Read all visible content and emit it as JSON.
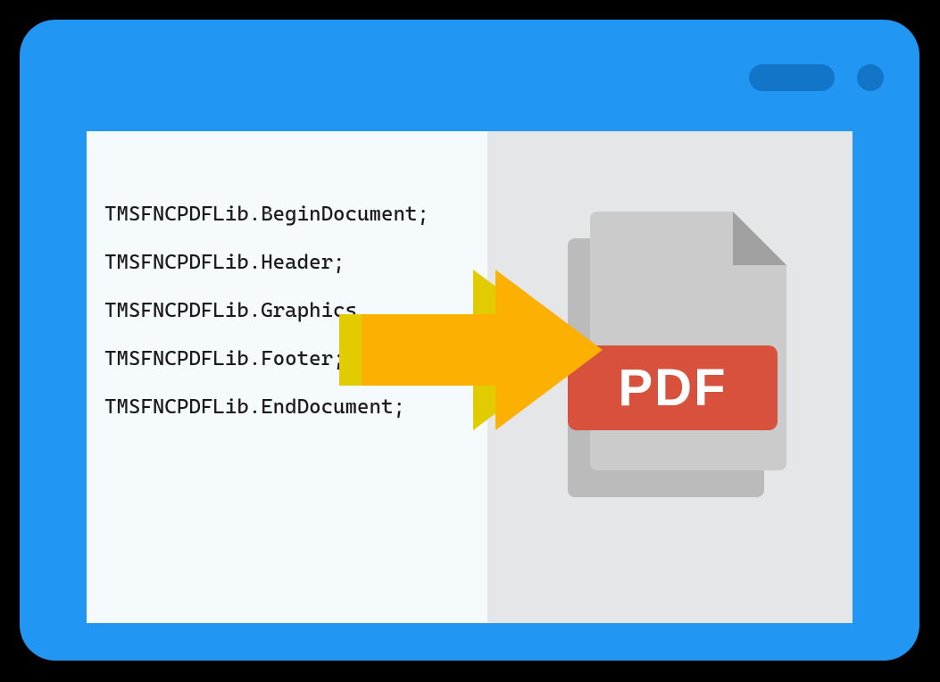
{
  "code_lines": [
    "TMSFNCPDFLib.BeginDocument;",
    "TMSFNCPDFLib.Header;",
    "TMSFNCPDFLib.Graphics",
    "TMSFNCPDFLib.Footer;",
    "TMSFNCPDFLib.EndDocument;"
  ],
  "pdf_label": "PDF",
  "colors": {
    "window_bg": "#2196f3",
    "control": "#1375c7",
    "code_bg": "#f5fafd",
    "output_bg": "#e5e6e8",
    "pdf_badge": "#d8513d",
    "arrow_front": "#fbb002",
    "arrow_back": "#e0cc00"
  }
}
